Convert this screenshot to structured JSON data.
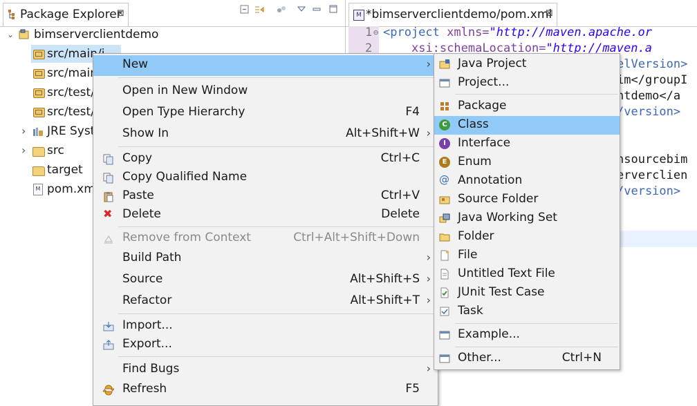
{
  "package_explorer": {
    "tab_title": "Package Explorer",
    "close_glyph": "⊠",
    "toolbar_icons": [
      "collapse-all-icon",
      "link-with-editor-icon",
      "focus-icon",
      "view-menu-icon",
      "minimize-icon",
      "maximize-icon"
    ],
    "tree": [
      {
        "label": "bimserverclientdemo",
        "icon": "project-icon",
        "arrow": "⌄"
      },
      {
        "label": "src/main/j",
        "icon": "package-folder-icon",
        "selected": true
      },
      {
        "label": "src/main",
        "icon": "package-folder-icon"
      },
      {
        "label": "src/test/j",
        "icon": "package-folder-icon"
      },
      {
        "label": "src/test/",
        "icon": "package-folder-icon"
      },
      {
        "label": "JRE Syste",
        "icon": "library-icon",
        "arrow": "›"
      },
      {
        "label": "src",
        "icon": "folder-icon",
        "arrow": "›"
      },
      {
        "label": "target",
        "icon": "folder-icon"
      },
      {
        "label": "pom.xml",
        "icon": "maven-file-icon"
      }
    ]
  },
  "editor": {
    "tab_title": "*bimserverclientdemo/pom.xml",
    "tab_icon_text": "M",
    "close_glyph": "⊠",
    "line_numbers": [
      "1",
      "2"
    ],
    "fold_marker": "⊖",
    "lines": [
      {
        "tag": "<project ",
        "attr": "xmlns=",
        "val": "\"http://maven.apache.or"
      },
      {
        "tag": "  ",
        "attr": "xsi:schemaLocation=",
        "val": "\"http://maven.a"
      }
    ],
    "fragments": [
      "elVersion>",
      "im</groupI",
      "ntdemo</a",
      "/version>",
      "nsourcebim",
      "erverclien",
      "/version>"
    ]
  },
  "context_menu": {
    "items": [
      {
        "label": "New",
        "submenu": true,
        "hover": true
      },
      {
        "label": "Open in New Window"
      },
      {
        "label": "Open Type Hierarchy",
        "accel": "F4"
      },
      {
        "label": "Show In",
        "accel": "Alt+Shift+W",
        "submenu": true
      },
      {
        "label": "Copy",
        "accel": "Ctrl+C",
        "icon": "copy-icon"
      },
      {
        "label": "Copy Qualified Name",
        "icon": "copy-qualified-icon"
      },
      {
        "label": "Paste",
        "accel": "Ctrl+V",
        "icon": "paste-icon"
      },
      {
        "label": "Delete",
        "accel": "Delete",
        "icon": "delete-icon"
      },
      {
        "label": "Remove from Context",
        "accel": "Ctrl+Alt+Shift+Down",
        "icon": "remove-context-icon",
        "disabled": true
      },
      {
        "label": "Build Path",
        "submenu": true
      },
      {
        "label": "Source",
        "accel": "Alt+Shift+S",
        "submenu": true
      },
      {
        "label": "Refactor",
        "accel": "Alt+Shift+T",
        "submenu": true
      },
      {
        "label": "Import...",
        "icon": "import-icon"
      },
      {
        "label": "Export...",
        "icon": "export-icon"
      },
      {
        "label": "Find Bugs",
        "submenu": true
      },
      {
        "label": "Refresh",
        "accel": "F5",
        "icon": "refresh-icon"
      }
    ],
    "submenu_arrow": "›",
    "delete_glyph": "✖"
  },
  "new_submenu": {
    "items": [
      {
        "label": "Java Project",
        "icon": "java-project-icon"
      },
      {
        "label": "Project...",
        "icon": "project-wizard-icon"
      },
      {
        "label": "Package",
        "icon": "package-icon"
      },
      {
        "label": "Class",
        "icon": "class-icon",
        "hover": true,
        "glyph": "C"
      },
      {
        "label": "Interface",
        "icon": "interface-icon",
        "glyph": "I"
      },
      {
        "label": "Enum",
        "icon": "enum-icon",
        "glyph": "E"
      },
      {
        "label": "Annotation",
        "icon": "annotation-icon",
        "glyph": "@"
      },
      {
        "label": "Source Folder",
        "icon": "source-folder-icon"
      },
      {
        "label": "Java Working Set",
        "icon": "working-set-icon"
      },
      {
        "label": "Folder",
        "icon": "folder-icon"
      },
      {
        "label": "File",
        "icon": "file-icon"
      },
      {
        "label": "Untitled Text File",
        "icon": "text-file-icon"
      },
      {
        "label": "JUnit Test Case",
        "icon": "junit-icon"
      },
      {
        "label": "Task",
        "icon": "task-icon"
      },
      {
        "label": "Example...",
        "icon": "example-icon"
      },
      {
        "label": "Other...",
        "accel": "Ctrl+N",
        "icon": "other-wizard-icon"
      }
    ]
  },
  "colors": {
    "menu_bg": "#f2f2f2",
    "hover": "#91c9f7",
    "selection": "#cce4f7",
    "xml_tag": "#3b67b9",
    "xml_attr": "#7f3fa0",
    "xml_value": "#2a00ff"
  }
}
